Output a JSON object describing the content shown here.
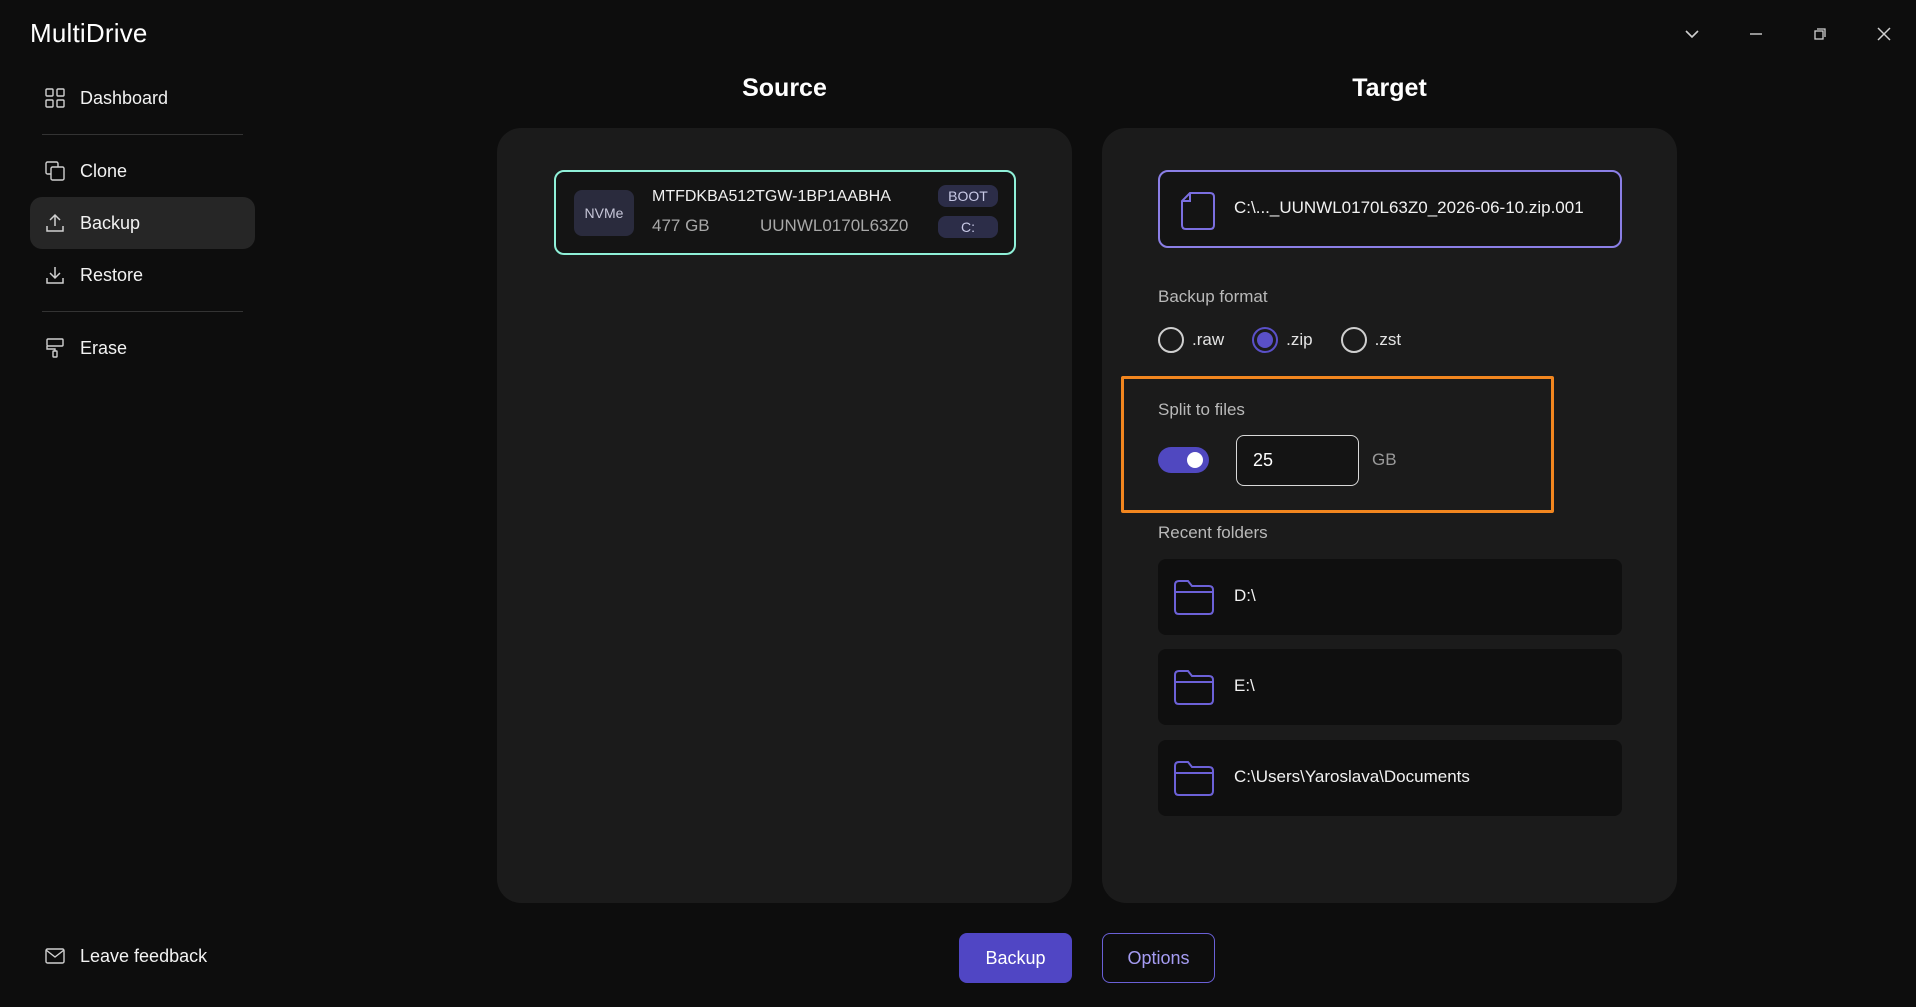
{
  "app": {
    "title": "MultiDrive"
  },
  "window_controls": [
    "chevron-down-icon",
    "minimize-icon",
    "restore-icon",
    "close-icon"
  ],
  "sidebar": {
    "items": [
      {
        "label": "Dashboard",
        "icon": "dashboard-icon"
      },
      {
        "label": "Clone",
        "icon": "clone-icon"
      },
      {
        "label": "Backup",
        "icon": "upload-icon",
        "active": true
      },
      {
        "label": "Restore",
        "icon": "download-icon"
      },
      {
        "label": "Erase",
        "icon": "paint-roller-icon"
      }
    ],
    "feedback": {
      "label": "Leave feedback",
      "icon": "mail-icon"
    }
  },
  "source": {
    "heading": "Source",
    "disk": {
      "type_badge": "NVMe",
      "model": "MTFDKBA512TGW-1BP1AABHA",
      "size": "477 GB",
      "serial": "UUNWL0170L63Z0",
      "boot_tag": "BOOT",
      "drive_tag": "C:"
    }
  },
  "target": {
    "heading": "Target",
    "path": "C:\\..._UUNWL0170L63Z0_2026-06-10.zip.001",
    "backup_format": {
      "label": "Backup format",
      "options": [
        {
          "label": ".raw",
          "checked": false
        },
        {
          "label": ".zip",
          "checked": true
        },
        {
          "label": ".zst",
          "checked": false
        }
      ]
    },
    "split": {
      "label": "Split to files",
      "enabled": true,
      "value": "25",
      "unit": "GB"
    },
    "recent_folders": {
      "label": "Recent folders",
      "items": [
        {
          "path": "D:\\"
        },
        {
          "path": "E:\\"
        },
        {
          "path": "C:\\Users\\Yaroslava\\Documents"
        }
      ]
    }
  },
  "actions": {
    "backup_label": "Backup",
    "options_label": "Options"
  },
  "colors": {
    "accent": "#5046c4",
    "source_border": "#8ff0d8",
    "target_border": "#8b7fe6",
    "highlight": "#f2861f"
  }
}
